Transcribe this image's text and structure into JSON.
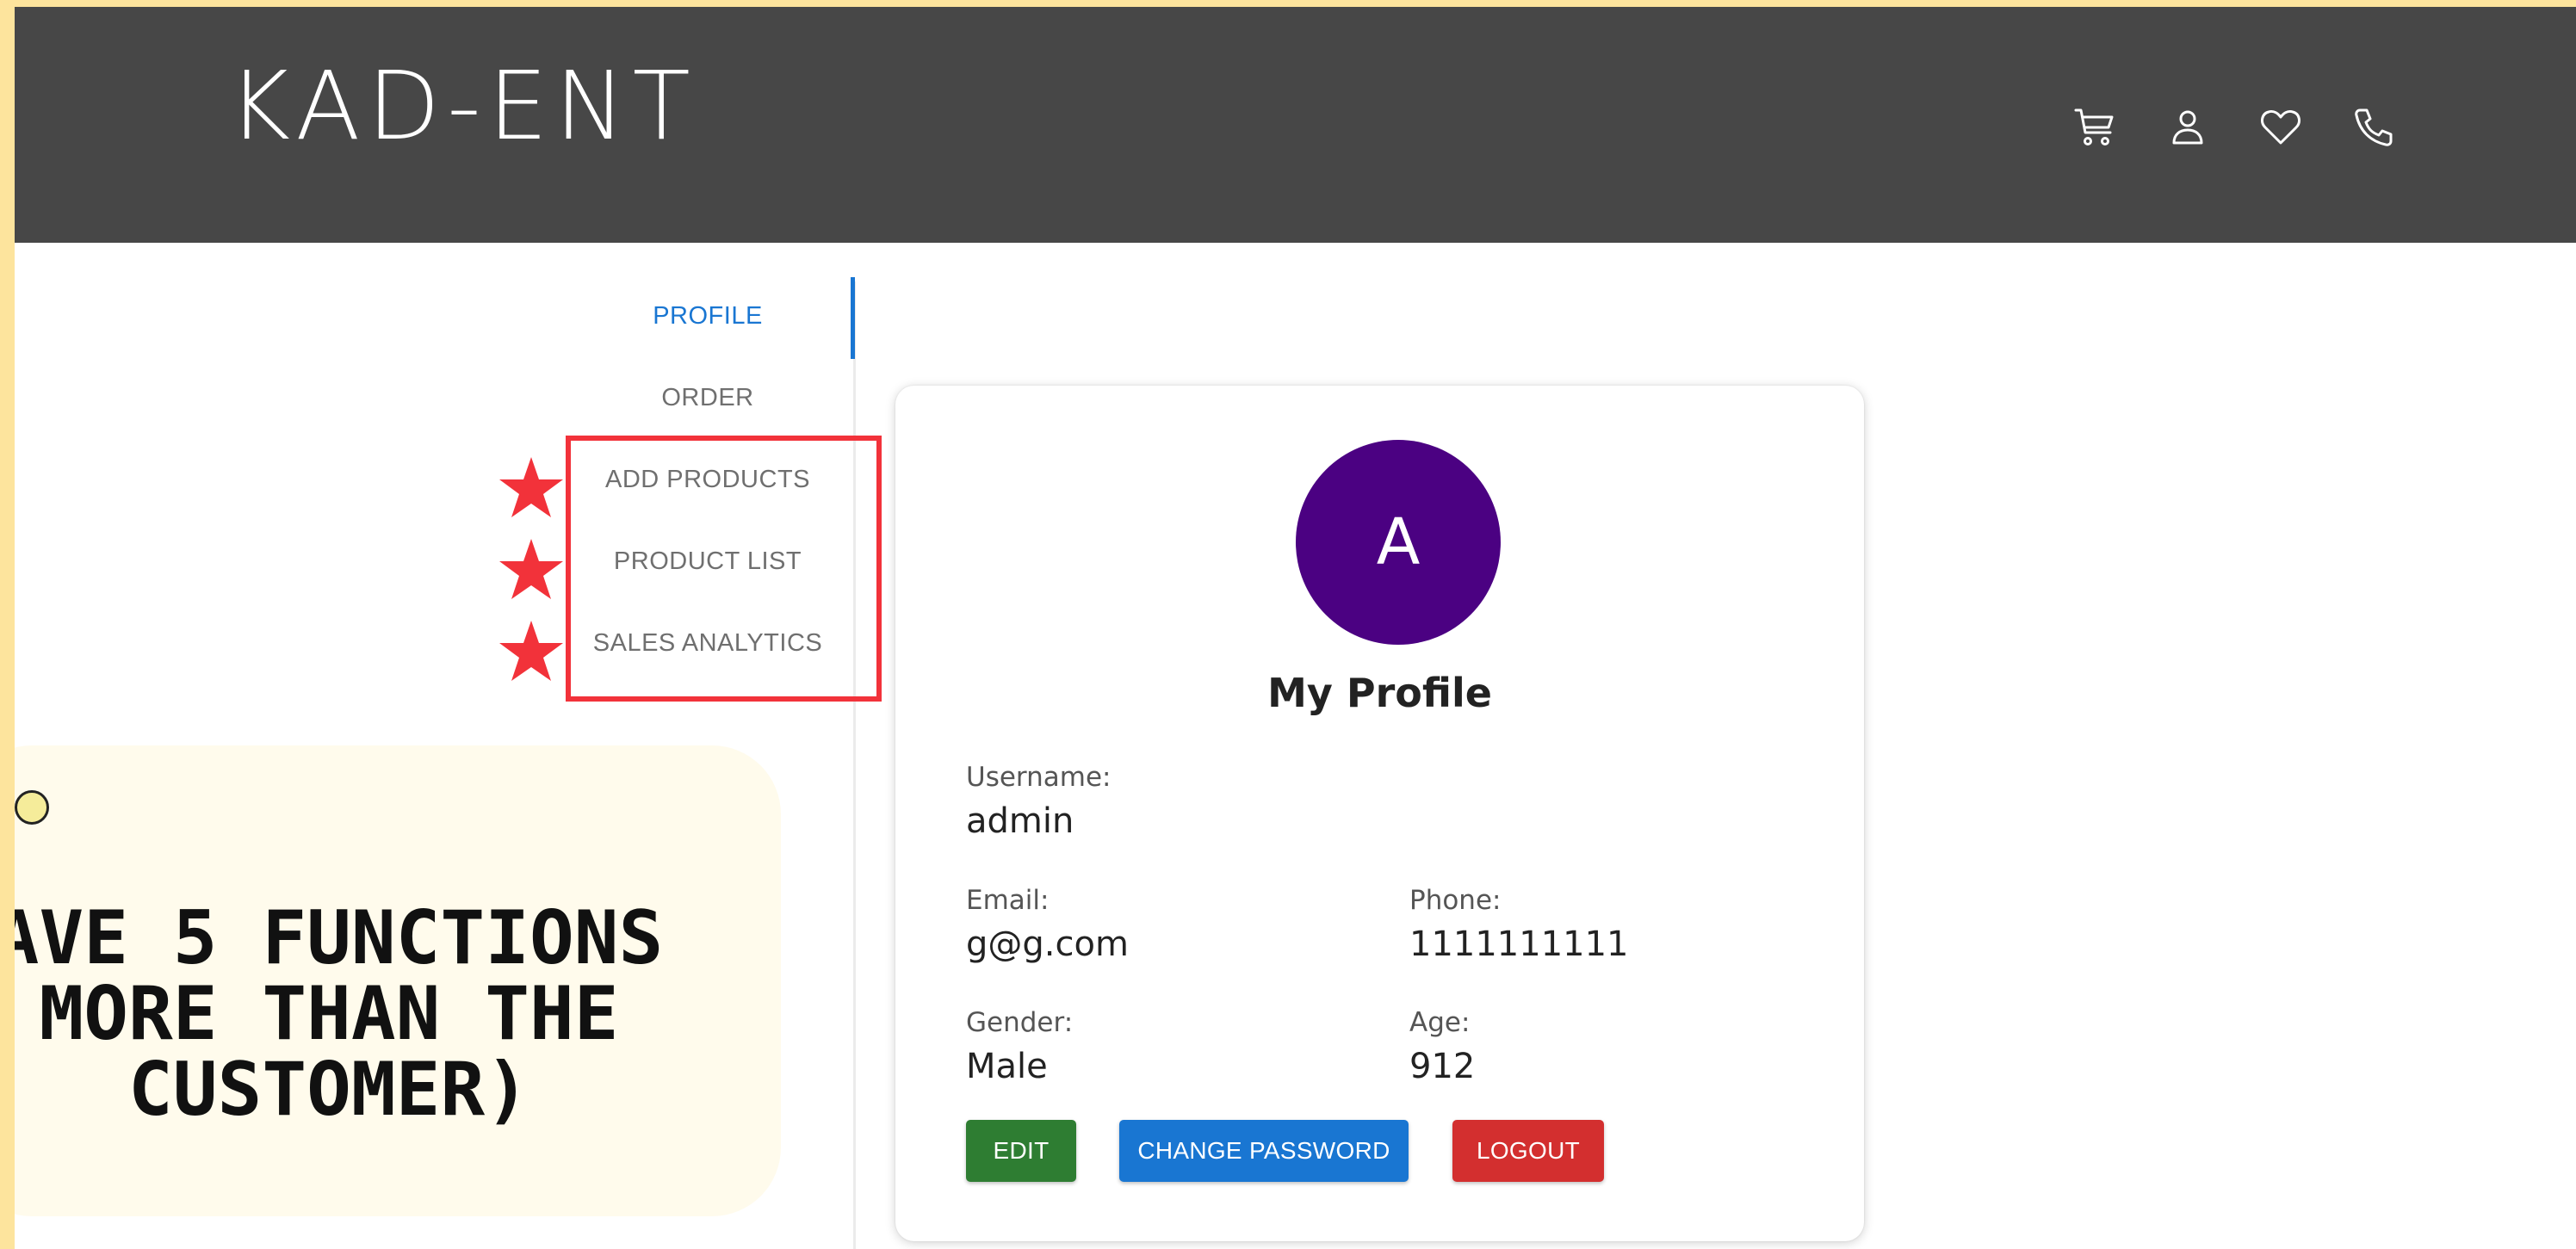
{
  "header": {
    "brand": "KAD-ENT",
    "icons": [
      "cart-icon",
      "user-icon",
      "heart-icon",
      "phone-icon"
    ]
  },
  "sidebar": {
    "items": [
      {
        "label": "PROFILE",
        "active": true
      },
      {
        "label": "ORDER",
        "active": false
      },
      {
        "label": "ADD PRODUCTS",
        "active": false
      },
      {
        "label": "PRODUCT LIST",
        "active": false
      },
      {
        "label": "SALES ANALYTICS",
        "active": false
      }
    ]
  },
  "callout": {
    "text": "AVE 5 FUNCTIONS\nMORE THAN THE\nCUSTOMER)"
  },
  "profile": {
    "avatar_letter": "A",
    "title": "My Profile",
    "username_label": "Username:",
    "username": "admin",
    "email_label": "Email:",
    "email": "g@g.com",
    "phone_label": "Phone:",
    "phone": "1111111111",
    "gender_label": "Gender:",
    "gender": "Male",
    "age_label": "Age:",
    "age": "912"
  },
  "buttons": {
    "edit": "EDIT",
    "change_password": "CHANGE PASSWORD",
    "logout": "LOGOUT"
  },
  "colors": {
    "frame": "#fde49d",
    "header_bg": "#474747",
    "accent": "#1976d2",
    "avatar": "#4b0182",
    "highlight": "#f2323a",
    "edit": "#2e7d32",
    "logout": "#d32f2f"
  }
}
